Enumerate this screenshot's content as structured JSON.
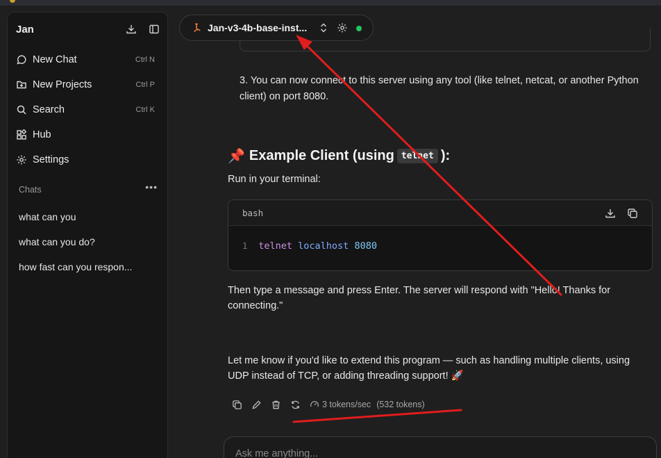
{
  "sidebar": {
    "app_name": "Jan",
    "nav": [
      {
        "label": "New Chat",
        "shortcut": "Ctrl N",
        "icon": "chat-bubble-icon"
      },
      {
        "label": "New Projects",
        "shortcut": "Ctrl P",
        "icon": "folder-plus-icon"
      },
      {
        "label": "Search",
        "shortcut": "Ctrl K",
        "icon": "search-icon"
      },
      {
        "label": "Hub",
        "shortcut": "",
        "icon": "blocks-icon"
      },
      {
        "label": "Settings",
        "shortcut": "",
        "icon": "gear-icon"
      }
    ],
    "chats_heading": "Chats",
    "chats": [
      "what can you",
      "what can you do?",
      "how fast can you respon..."
    ]
  },
  "model": {
    "name": "Jan-v3-4b-base-inst...",
    "status_color": "#22c55e"
  },
  "message": {
    "step3": "3. You can now connect to this server using any tool (like telnet, netcat, or another Python client) on port 8080.",
    "heading_emoji": "📌",
    "heading_prefix": "Example Client (using",
    "heading_code": "telnet",
    "heading_suffix": "):",
    "run_line": "Run in your terminal:",
    "code_lang": "bash",
    "code_line_number": "1",
    "code_tokens": [
      "telnet",
      "localhost",
      "8080"
    ],
    "then_text": "Then type a message and press Enter. The server will respond with \"Hello! Thanks for connecting.\"",
    "letme_text": "Let me know if you'd like to extend this program — such as handling multiple clients, using UDP instead of TCP, or adding threading support! 🚀",
    "speed": "3 tokens/sec",
    "tokens": "(532 tokens)"
  },
  "input": {
    "placeholder": "Ask me anything..."
  },
  "annotation_color": "#e11d1d"
}
